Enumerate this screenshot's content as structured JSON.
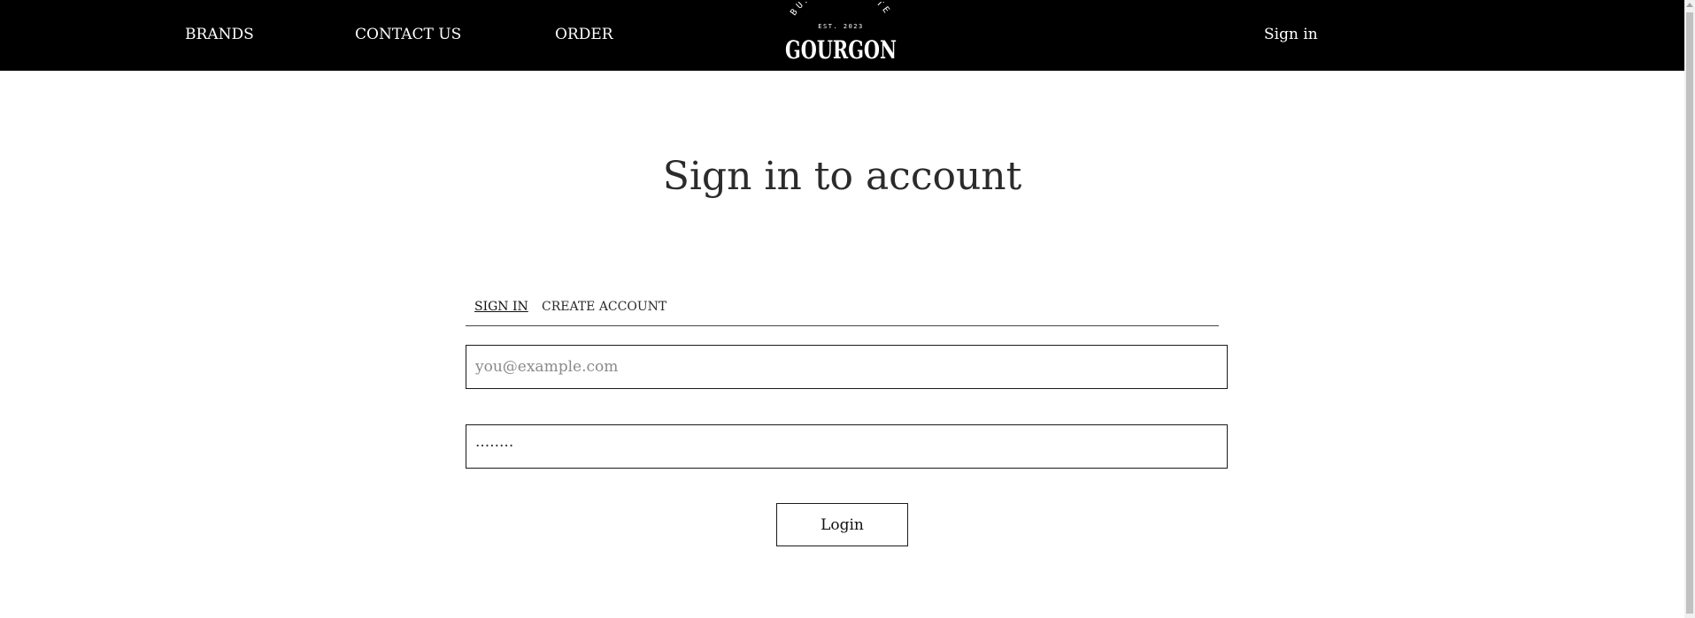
{
  "nav": {
    "brands": "BRANDS",
    "contact": "CONTACT US",
    "order": "ORDER",
    "sign_in": "Sign in"
  },
  "logo": {
    "tagline": "BURNING TASTE",
    "established": "EST. 2023",
    "wordmark": "GOURGON"
  },
  "page": {
    "title": "Sign in to account"
  },
  "tabs": [
    {
      "label": "SIGN IN",
      "active": true
    },
    {
      "label": "CREATE ACCOUNT",
      "active": false
    }
  ],
  "form": {
    "email_placeholder": "you@example.com",
    "email_value": "",
    "password_value": "········",
    "login_label": "Login"
  },
  "colors": {
    "nav_bg": "#000000",
    "nav_text": "#ffffff",
    "page_bg": "#ffffff",
    "text": "#2b2b2b"
  }
}
